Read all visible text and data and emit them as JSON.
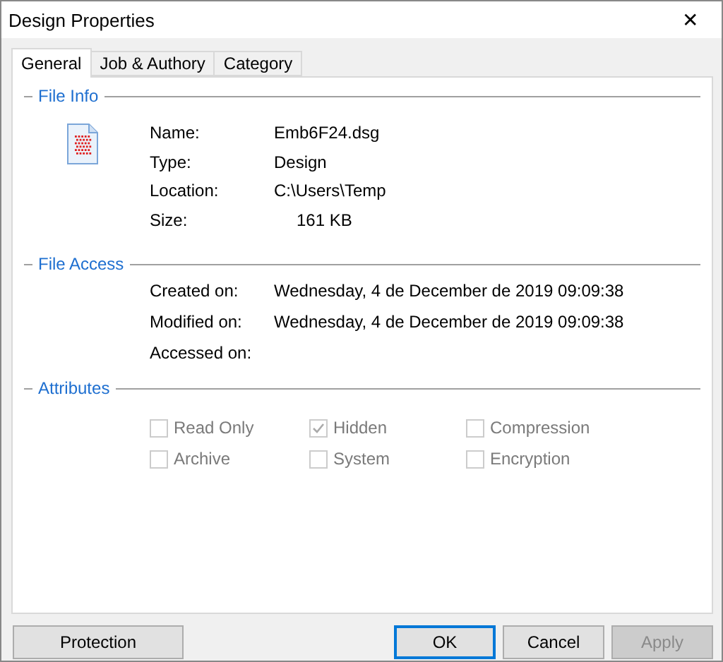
{
  "window": {
    "title": "Design Properties",
    "close": "✕"
  },
  "tabs": [
    {
      "label": "General",
      "selected": true
    },
    {
      "label": "Job & Authory",
      "selected": false
    },
    {
      "label": "Category",
      "selected": false
    }
  ],
  "file_info": {
    "title": "File Info",
    "rows": [
      {
        "label": "Name:",
        "value": "Emb6F24.dsg"
      },
      {
        "label": "Type:",
        "value": "Design"
      },
      {
        "label": "Location:",
        "value": "C:\\Users\\Temp"
      },
      {
        "label": "Size:",
        "value": "161 KB"
      }
    ]
  },
  "file_access": {
    "title": "File Access",
    "rows": [
      {
        "label": "Created on:",
        "value": "Wednesday, 4 de December de 2019 09:09:38"
      },
      {
        "label": "Modified on:",
        "value": "Wednesday, 4 de December de 2019 09:09:38"
      },
      {
        "label": "Accessed on:"
      }
    ]
  },
  "attributes": {
    "title": "Attributes",
    "items": [
      {
        "label": "Read Only",
        "checked": false,
        "disabled": true
      },
      {
        "label": "Hidden",
        "checked": true,
        "disabled": true
      },
      {
        "label": "Compression",
        "checked": false,
        "disabled": true
      },
      {
        "label": "Archive",
        "checked": false,
        "disabled": true
      },
      {
        "label": "System",
        "checked": false,
        "disabled": true
      },
      {
        "label": "Encryption",
        "checked": false,
        "disabled": true
      }
    ]
  },
  "buttons": [
    {
      "label": "Protection",
      "focused": false,
      "disabled": false
    },
    {
      "label": "OK",
      "focused": true,
      "disabled": false
    },
    {
      "label": "Cancel",
      "focused": false,
      "disabled": false
    },
    {
      "label": "Apply",
      "focused": false,
      "disabled": true
    }
  ]
}
